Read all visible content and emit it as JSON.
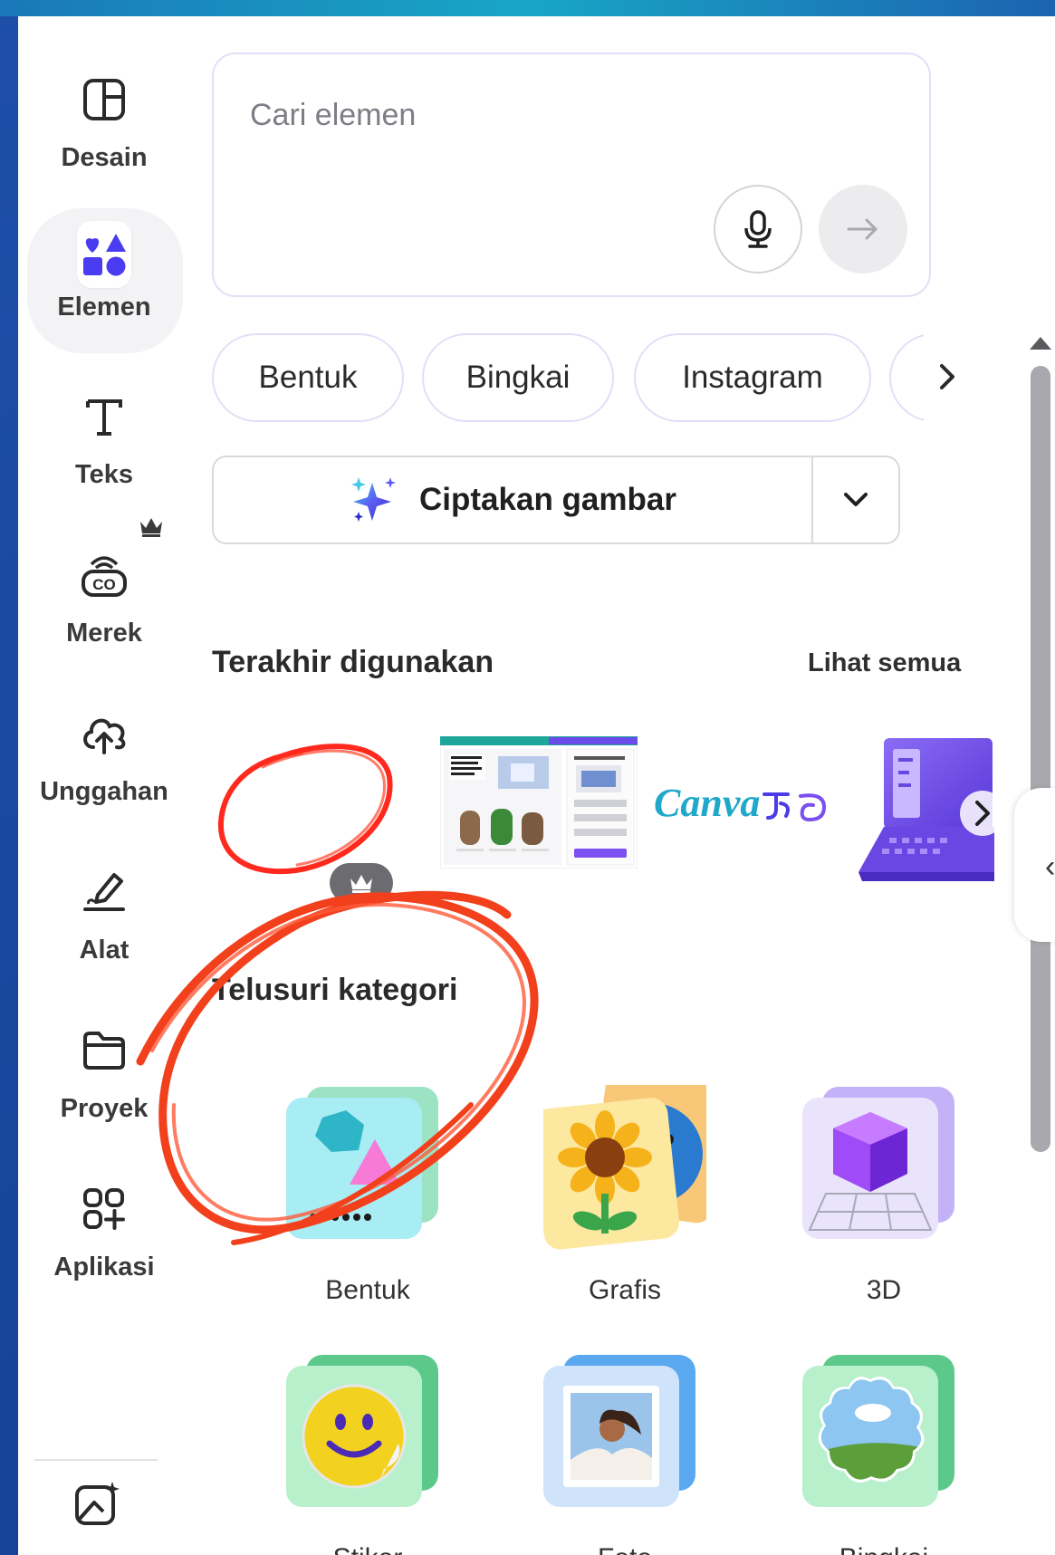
{
  "sidebar": {
    "items": [
      {
        "label": "Desain",
        "icon": "layout-icon"
      },
      {
        "label": "Elemen",
        "icon": "shapes-icon",
        "active": true
      },
      {
        "label": "Teks",
        "icon": "text-t-icon"
      },
      {
        "label": "Merek",
        "icon": "brand-co-icon",
        "badge": "crown-icon"
      },
      {
        "label": "Unggahan",
        "icon": "cloud-upload-icon"
      },
      {
        "label": "Alat",
        "icon": "pen-tool-icon"
      },
      {
        "label": "Proyek",
        "icon": "folder-icon"
      },
      {
        "label": "Aplikasi",
        "icon": "apps-grid-icon"
      }
    ],
    "bottom_icon": "magic-image-icon"
  },
  "search": {
    "placeholder": "Cari elemen",
    "mic_icon": "microphone-icon",
    "submit_icon": "arrow-right-icon"
  },
  "chips": [
    "Bentuk",
    "Bingkai",
    "Instagram"
  ],
  "chips_next_icon": "chevron-right-icon",
  "generate": {
    "label": "Ciptakan gambar",
    "icon": "sparkle-icon",
    "dropdown_icon": "chevron-down-icon"
  },
  "recent": {
    "title": "Terakhir digunakan",
    "see_all": "Lihat semua",
    "items": [
      {
        "name": "red-circle-scribble",
        "badge": "crown-icon"
      },
      {
        "name": "canva-screenshot-thumbnail"
      },
      {
        "name": "canva-logo-text",
        "text": "Canva"
      },
      {
        "name": "laptop-illustration"
      }
    ],
    "next_icon": "chevron-right-icon"
  },
  "categories": {
    "title": "Telusuri kategori",
    "items": [
      {
        "label": "Bentuk",
        "icon": "shapes-category-icon"
      },
      {
        "label": "Grafis",
        "icon": "graphics-category-icon"
      },
      {
        "label": "3D",
        "icon": "3d-cube-category-icon"
      },
      {
        "label": "Stiker",
        "icon": "sticker-category-icon"
      },
      {
        "label": "Foto",
        "icon": "photo-category-icon"
      },
      {
        "label": "Bingkai",
        "icon": "frame-category-icon"
      }
    ]
  },
  "colors": {
    "accent": "#8b3dff",
    "annotation": "#f2401c",
    "element_icon": "#4a3cf0",
    "background": "#1e4fa8"
  }
}
